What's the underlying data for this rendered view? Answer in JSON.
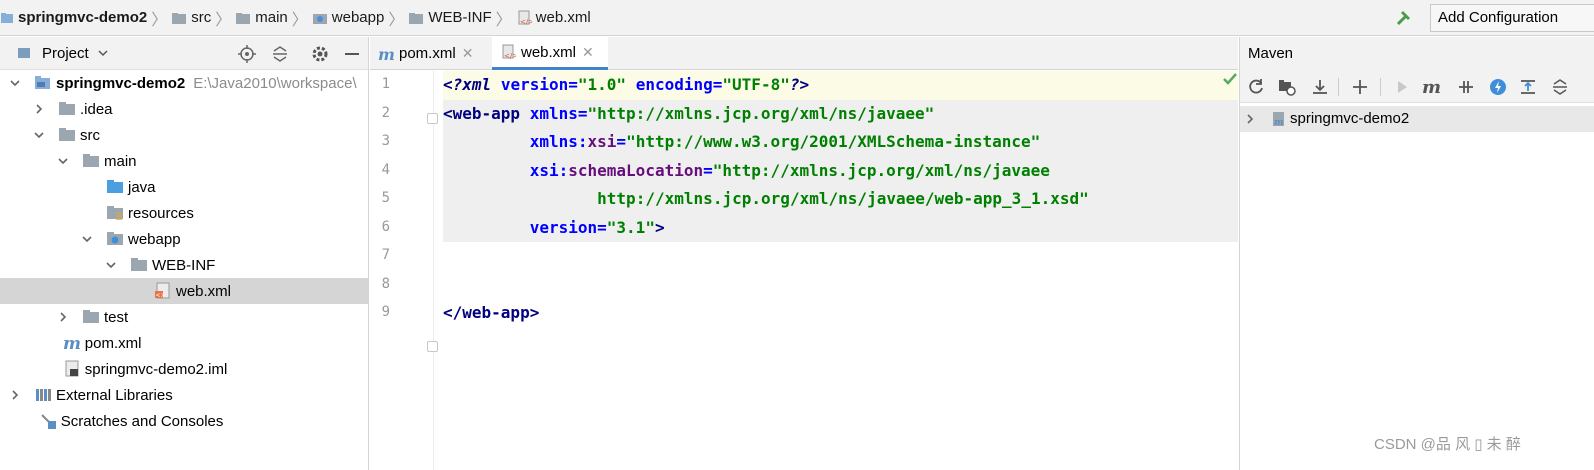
{
  "nav": {
    "breadcrumbs": [
      "springmvc-demo2",
      "src",
      "main",
      "webapp",
      "WEB-INF",
      "web.xml"
    ],
    "add_configuration": "Add Configuration"
  },
  "project": {
    "title": "Project",
    "tree": [
      {
        "label": "springmvc-demo2",
        "path": "E:\\Java2010\\workspace\\",
        "icon": "module-folder-icon",
        "expanded": true
      },
      {
        "label": ".idea",
        "icon": "folder-icon",
        "expanded": false
      },
      {
        "label": "src",
        "icon": "folder-icon",
        "expanded": true
      },
      {
        "label": "main",
        "icon": "folder-icon",
        "expanded": true
      },
      {
        "label": "java",
        "icon": "source-folder-icon"
      },
      {
        "label": "resources",
        "icon": "resources-folder-icon"
      },
      {
        "label": "webapp",
        "icon": "web-folder-icon",
        "expanded": true
      },
      {
        "label": "WEB-INF",
        "icon": "folder-icon",
        "expanded": true
      },
      {
        "label": "web.xml",
        "icon": "xml-file-icon",
        "selected": true
      },
      {
        "label": "test",
        "icon": "folder-icon",
        "expanded": false
      },
      {
        "label": "pom.xml",
        "icon": "maven-file-icon"
      },
      {
        "label": "springmvc-demo2.iml",
        "icon": "iml-file-icon"
      },
      {
        "label": "External Libraries",
        "icon": "libraries-icon",
        "expanded": false
      },
      {
        "label": "Scratches and Consoles",
        "icon": "scratches-icon"
      }
    ]
  },
  "editor": {
    "tabs": [
      {
        "label": "pom.xml",
        "icon": "maven-file-icon",
        "active": false
      },
      {
        "label": "web.xml",
        "icon": "xml-file-icon",
        "active": true
      }
    ],
    "line_numbers": [
      "1",
      "2",
      "3",
      "4",
      "5",
      "6",
      "7",
      "8",
      "9"
    ],
    "lines": [
      "<?xml version=\"1.0\" encoding=\"UTF-8\"?>",
      "<web-app xmlns=\"http://xmlns.jcp.org/xml/ns/javaee\"",
      "         xmlns:xsi=\"http://www.w3.org/2001/XMLSchema-instance\"",
      "         xsi:schemaLocation=\"http://xmlns.jcp.org/xml/ns/javaee",
      "                http://xmlns.jcp.org/xml/ns/javaee/web-app_3_1.xsd\"",
      "         version=\"3.1\">",
      "",
      "",
      "</web-app>"
    ]
  },
  "maven": {
    "title": "Maven",
    "root": "springmvc-demo2"
  },
  "watermark": "CSDN @品 风 ▯ 未 醉",
  "colors": {
    "accent": "#4083c9",
    "xml_tag": "#000080",
    "xml_attr": "#0000ff",
    "xml_value": "#008000",
    "xml_namespace": "#660e7a"
  }
}
